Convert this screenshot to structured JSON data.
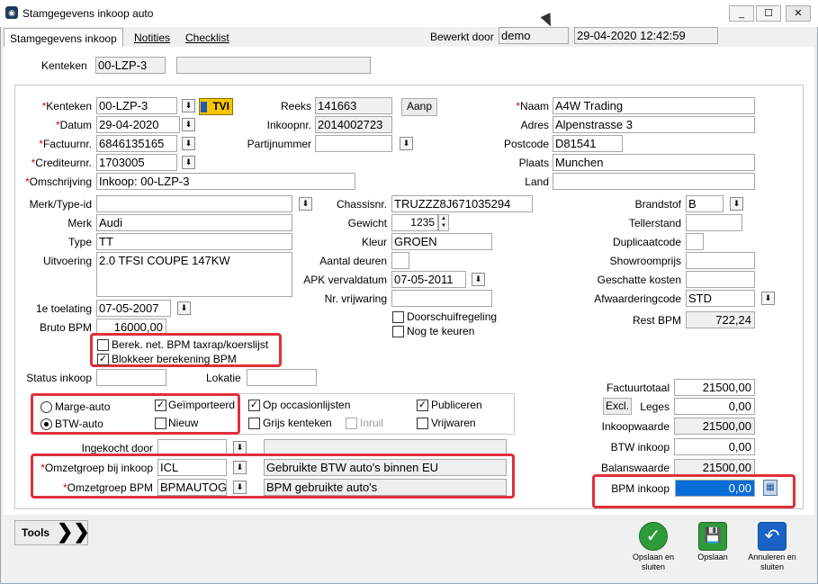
{
  "window": {
    "title": "Stamgegevens inkoop auto",
    "min": "_",
    "max": "☐",
    "close": "✕"
  },
  "tabs": [
    "Stamgegevens inkoop",
    "Notities",
    "Checklist"
  ],
  "header": {
    "bewerkt_label": "Bewerkt door",
    "bewerkt_value": "demo",
    "datetime": "29-04-2020 12:42:59"
  },
  "top": {
    "kenteken_label": "Kenteken",
    "kenteken_value": "00-LZP-3",
    "extra": ""
  },
  "left": {
    "kenteken_label": "Kenteken",
    "kenteken_value": "00-LZP-3",
    "tvi": "TVI",
    "datum_label": "Datum",
    "datum_value": "29-04-2020",
    "factuurnr_label": "Factuurnr.",
    "factuurnr_value": "6846135165",
    "crediteurnr_label": "Crediteurnr.",
    "crediteurnr_value": "1703005",
    "omschrijving_label": "Omschrijving",
    "omschrijving_value": "Inkoop: 00-LZP-3",
    "merktype_label": "Merk/Type-id",
    "merktype_value": "",
    "merk_label": "Merk",
    "merk_value": "Audi",
    "type_label": "Type",
    "type_value": "TT",
    "uitvoering_label": "Uitvoering",
    "uitvoering_value": "2.0 TFSI COUPE 147KW",
    "toelating_label": "1e toelating",
    "toelating_value": "07-05-2007",
    "brutobpm_label": "Bruto BPM",
    "brutobpm_value": "16000,00",
    "berek_label": "Berek. net. BPM taxrap/koerslijst",
    "blokkeer_label": "Blokkeer berekening BPM",
    "status_label": "Status inkoop",
    "locatie_label": "Lokatie",
    "marge_label": "Marge-auto",
    "btw_label": "BTW-auto",
    "geimp_label": "Geïmporteerd",
    "nieuw_label": "Nieuw",
    "occ_label": "Op occasionlijsten",
    "grijs_label": "Grijs kenteken",
    "inruil_label": "Inruil",
    "publ_label": "Publiceren",
    "vrijw_label": "Vrijwaren",
    "ingekocht_label": "Ingekocht door",
    "omzet_label": "Omzetgroep bij inkoop",
    "omzet_code": "ICL",
    "omzet_desc": "Gebruikte BTW auto's binnen EU",
    "omzetbpm_label": "Omzetgroep BPM",
    "omzetbpm_code": "BPMAUTOGE",
    "omzetbpm_desc": "BPM gebruikte auto's"
  },
  "mid": {
    "reeks_label": "Reeks",
    "reeks_value": "141663",
    "aanp": "Aanp",
    "inkoopnr_label": "Inkoopnr.",
    "inkoopnr_value": "2014002723",
    "partij_label": "Partijnummer",
    "chassis_label": "Chassisnr.",
    "chassis_value": "TRUZZZ8J671035294",
    "gewicht_label": "Gewicht",
    "gewicht_value": "1235",
    "kleur_label": "Kleur",
    "kleur_value": "GROEN",
    "deuren_label": "Aantal deuren",
    "apk_label": "APK vervaldatum",
    "apk_value": "07-05-2011",
    "vrijw_label": "Nr. vrijwaring",
    "door_label": "Doorschuifregeling",
    "nog_label": "Nog te keuren"
  },
  "right": {
    "naam_label": "Naam",
    "naam_value": "A4W Trading",
    "adres_label": "Adres",
    "adres_value": "Alpenstrasse 3",
    "postcode_label": "Postcode",
    "postcode_value": "D81541",
    "plaats_label": "Plaats",
    "plaats_value": "Munchen",
    "land_label": "Land",
    "brandstof_label": "Brandstof",
    "brandstof_value": "B",
    "teller_label": "Tellerstand",
    "dupl_label": "Duplicaatcode",
    "show_label": "Showroomprijs",
    "geschat_label": "Geschatte kosten",
    "afw_label": "Afwaarderingcode",
    "afw_value": "STD",
    "rest_label": "Rest BPM",
    "rest_value": "722,24",
    "factotaal_label": "Factuurtotaal",
    "factotaal_value": "21500,00",
    "excl": "Excl.",
    "leges_label": "Leges",
    "leges_value": "0,00",
    "inkw_label": "Inkoopwaarde",
    "inkw_value": "21500,00",
    "btwink_label": "BTW inkoop",
    "btwink_value": "0,00",
    "balans_label": "Balanswaarde",
    "balans_value": "21500,00",
    "bpmink_label": "BPM inkoop",
    "bpmink_value": "0,00"
  },
  "footer": {
    "tools": "Tools",
    "opslaan_sluiten": "Opslaan en sluiten",
    "opslaan": "Opslaan",
    "annuleren": "Annuleren en sluiten"
  }
}
